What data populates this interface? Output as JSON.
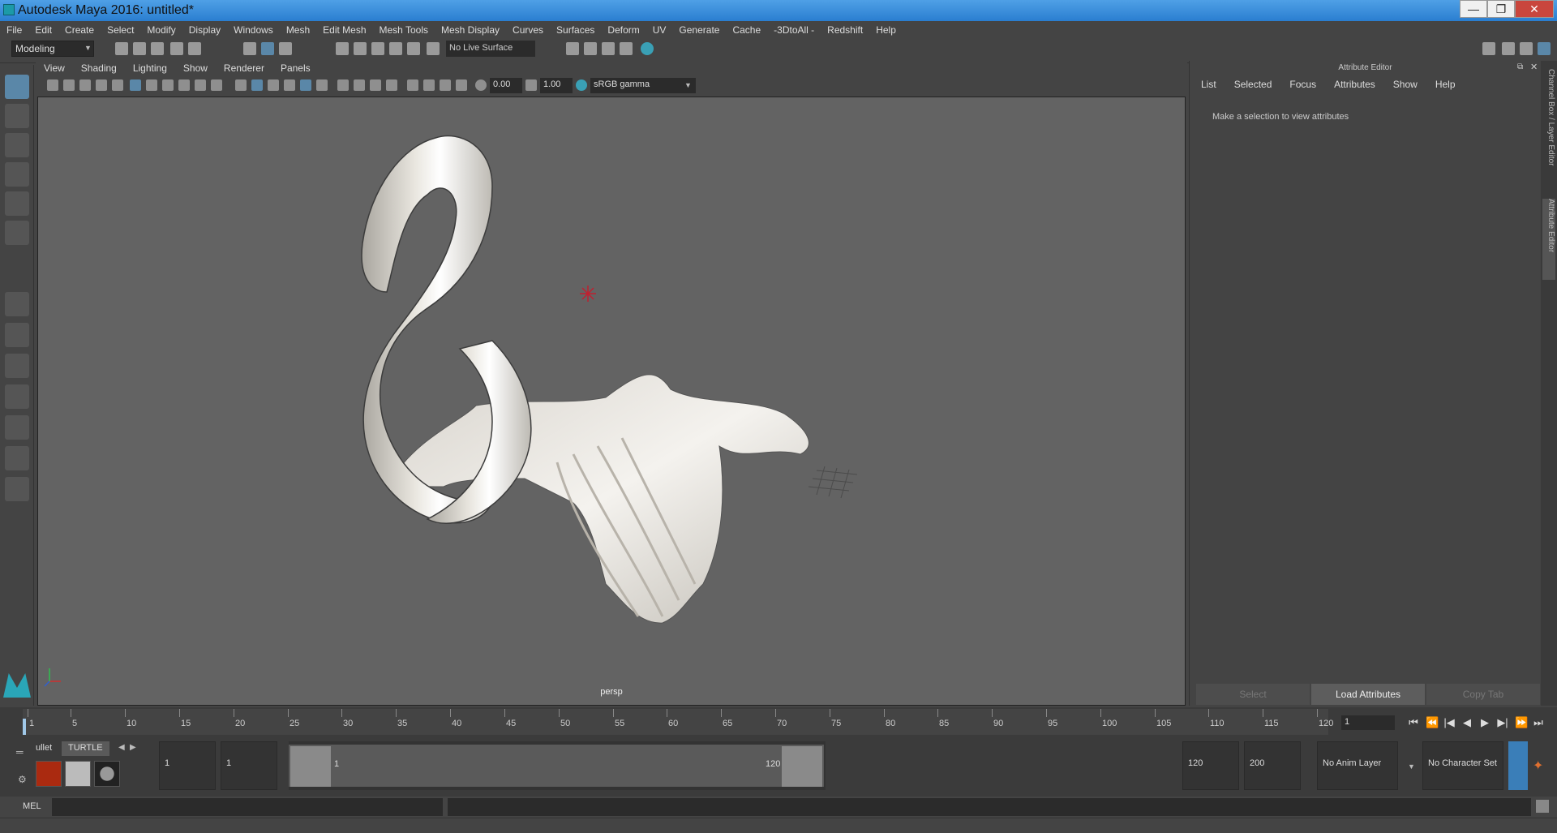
{
  "window": {
    "title": "Autodesk Maya 2016: untitled*",
    "minimize": "—",
    "maximize": "❐",
    "close": "✕"
  },
  "menubar": [
    "File",
    "Edit",
    "Create",
    "Select",
    "Modify",
    "Display",
    "Windows",
    "Mesh",
    "Edit Mesh",
    "Mesh Tools",
    "Mesh Display",
    "Curves",
    "Surfaces",
    "Deform",
    "UV",
    "Generate",
    "Cache",
    "-3DtoAll -",
    "Redshift",
    "Help"
  ],
  "statusline": {
    "mode": "Modeling",
    "live_surface": "No Live Surface"
  },
  "viewport": {
    "menu": [
      "View",
      "Shading",
      "Lighting",
      "Show",
      "Renderer",
      "Panels"
    ],
    "exposure": "0.00",
    "gamma": "1.00",
    "color_space": "sRGB gamma",
    "camera_label": "persp"
  },
  "attribute_editor": {
    "title": "Attribute Editor",
    "menu": [
      "List",
      "Selected",
      "Focus",
      "Attributes",
      "Show",
      "Help"
    ],
    "message": "Make a selection to view attributes",
    "buttons": {
      "select": "Select",
      "load": "Load Attributes",
      "copy": "Copy Tab"
    }
  },
  "side_tabs": {
    "channel_box": "Channel Box / Layer Editor",
    "attribute_editor": "Attribute Editor"
  },
  "timeline": {
    "ticks": [
      "1",
      "5",
      "10",
      "15",
      "20",
      "25",
      "30",
      "35",
      "40",
      "45",
      "50",
      "55",
      "60",
      "65",
      "70",
      "75",
      "80",
      "85",
      "90",
      "95",
      "100",
      "105",
      "110",
      "115",
      "120"
    ],
    "current_frame": "1"
  },
  "range": {
    "start": "1",
    "playback_start": "1",
    "slider_start": "1",
    "slider_end": "120",
    "playback_end": "120",
    "end": "200",
    "anim_layer": "No Anim Layer",
    "character_set": "No Character Set"
  },
  "shelf": {
    "tabs": [
      "ullet",
      "TURTLE"
    ]
  },
  "command_line": {
    "label": "MEL"
  },
  "colors": {
    "accent": "#5a87a8",
    "title_bar": "#2a7ed0",
    "close": "#c9463d"
  }
}
